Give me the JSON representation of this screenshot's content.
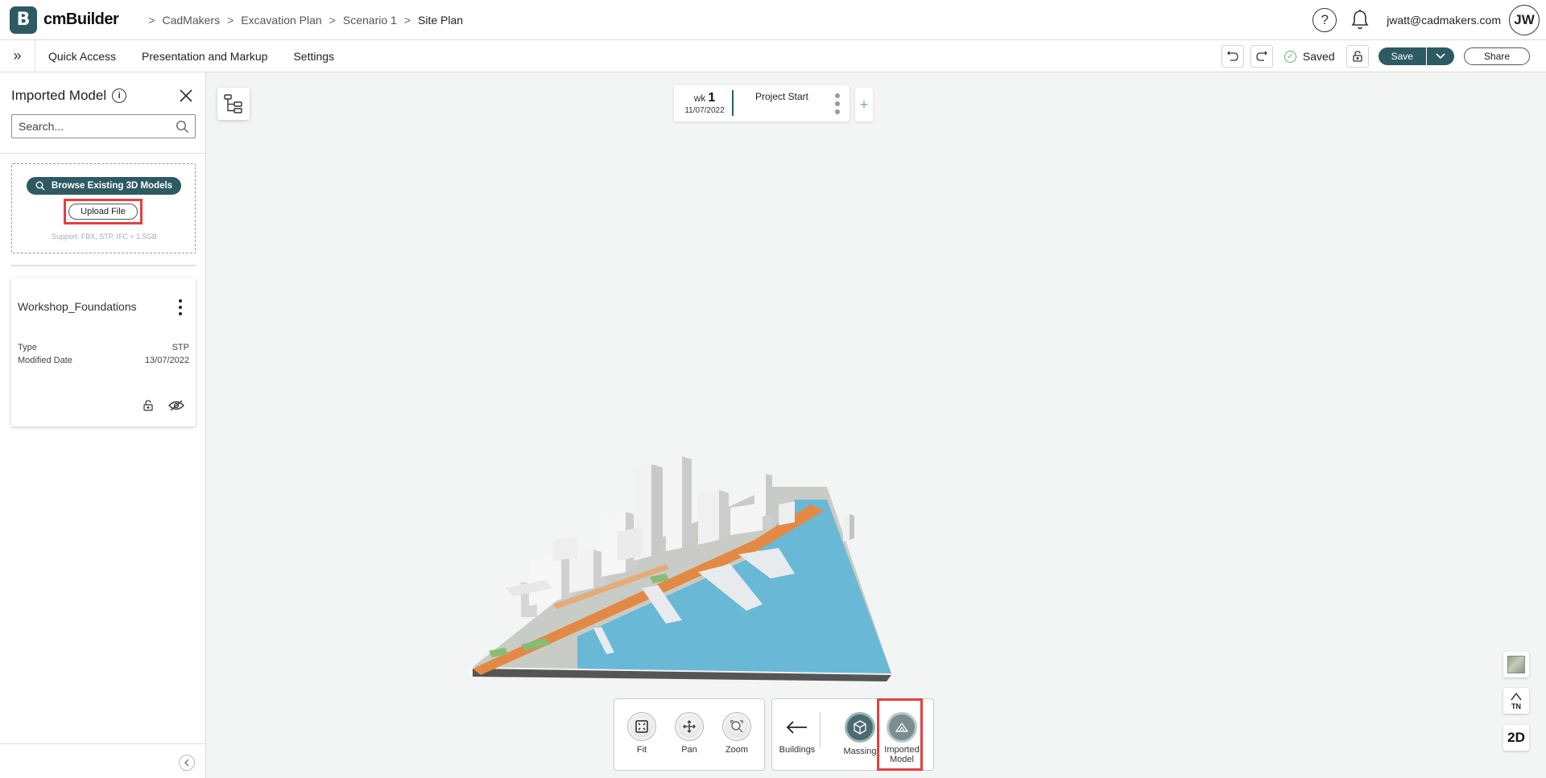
{
  "app": {
    "logo_letter": "B",
    "name": "cmBuilder",
    "brand_color": "#2d5a63",
    "highlight_color": "#e4403f"
  },
  "breadcrumb": [
    "CadMakers",
    "Excavation Plan",
    "Scenario 1",
    "Site Plan"
  ],
  "header": {
    "help_icon": "question-circle-icon",
    "help_glyph": "?",
    "notification_icon": "bell-icon",
    "user_email": "jwatt@cadmakers.com",
    "avatar_initials": "JW"
  },
  "menubar": {
    "expand_glyph": "»",
    "items": [
      "Quick Access",
      "Presentation and Markup",
      "Settings"
    ],
    "saved_label": "Saved",
    "save_label": "Save",
    "share_label": "Share"
  },
  "sidebar": {
    "title": "Imported Model",
    "search_placeholder": "Search...",
    "browse_label": "Browse Existing 3D Models",
    "upload_label": "Upload File",
    "support_text": "Support: FBX, STP, IFC < 1.5GB",
    "models": [
      {
        "name": "Workshop_Foundations",
        "type_label": "Type",
        "type_value": "STP",
        "date_label": "Modified Date",
        "date_value": "13/07/2022"
      }
    ]
  },
  "timeline": {
    "week_prefix": "wk",
    "week_number": "1",
    "date": "11/07/2022",
    "label": "Project Start",
    "add_glyph": "+"
  },
  "nav_tools": [
    {
      "label": "Fit",
      "icon": "fit-icon"
    },
    {
      "label": "Pan",
      "icon": "pan-icon"
    },
    {
      "label": "Zoom",
      "icon": "zoom-icon"
    }
  ],
  "layer_tools": {
    "back_label": "Buildings",
    "massing_label": "Massing",
    "imported_label_1": "Imported",
    "imported_label_2": "Model"
  },
  "right_controls": {
    "north_label": "TN",
    "view_mode": "2D"
  }
}
